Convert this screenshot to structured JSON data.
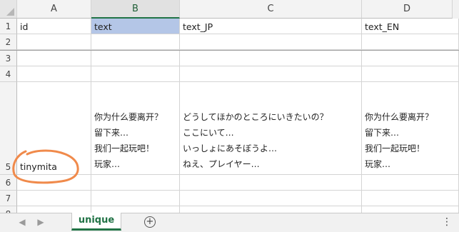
{
  "columns": [
    "A",
    "B",
    "C",
    "D"
  ],
  "rows": [
    "1",
    "2",
    "3",
    "4",
    "5",
    "6",
    "7",
    "8"
  ],
  "cells": {
    "A1": "id",
    "B1": "text",
    "C1": "text_JP",
    "D1": "text_EN",
    "A5": "tinymita",
    "B5": "你为什么要离开？\n留下来…\n我们一起玩吧！\n玩家…",
    "C5": "どうしてほかのところにいきたいの？\nここにいて…\nいっしょにあそぼうよ…\nねえ、プレイヤー…",
    "D5": "你为什么要离开？\n留下来…\n我们一起玩吧！\n玩家…"
  },
  "selected_cell": "B1",
  "annotation_color": "#f08a4b",
  "sheet_tab": {
    "label": "unique"
  },
  "icons": {
    "prev": "chevron-left-icon",
    "next": "chevron-right-icon",
    "add": "plus-circle-icon",
    "more": "vertical-ellipsis-icon"
  }
}
